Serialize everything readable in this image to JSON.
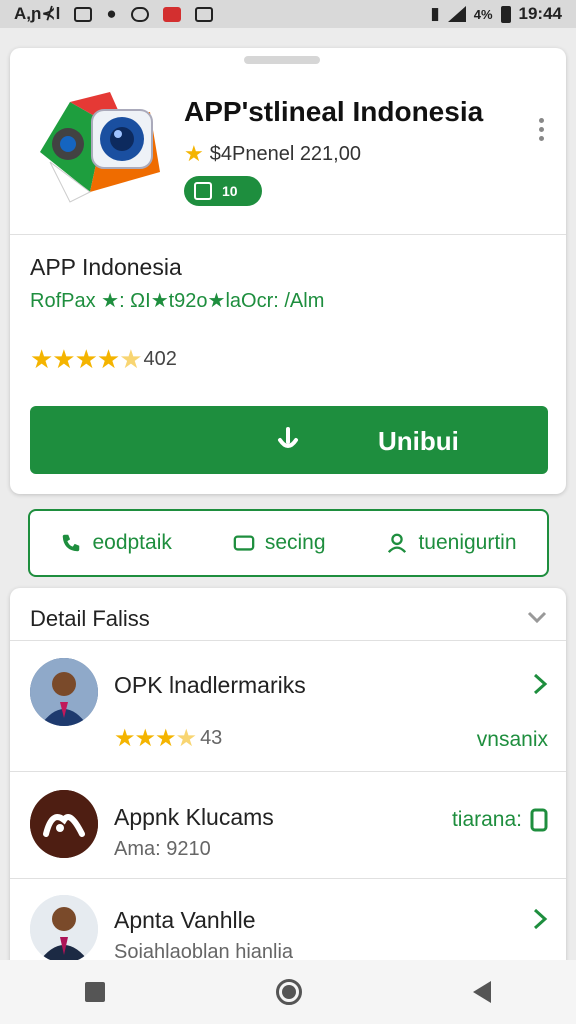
{
  "status_bar": {
    "carrier": "A,ɲ⊀l",
    "battery": "4%",
    "time": "19:44",
    "icons": [
      "mail-icon",
      "people-icon",
      "shield-icon",
      "youtube-icon",
      "image-icon",
      "vibrate-icon",
      "signal-icon",
      "battery-icon"
    ]
  },
  "app": {
    "title": "APP'stlineal Indonesia",
    "price": "$4Pnenel 221,00",
    "badge": "10",
    "name": "APP Indonesia",
    "meta": "RofPax ★: ΩI★t92o★laOcr: /Alm",
    "rating_stars": 4.5,
    "rating_count": "402",
    "install_label": "Unibui"
  },
  "actions": [
    {
      "label": "eodptaik",
      "icon": "phone-icon"
    },
    {
      "label": "secing",
      "icon": "square-icon"
    },
    {
      "label": "tuenigurtin",
      "icon": "person-icon"
    }
  ],
  "details": {
    "header": "Detail Faliss",
    "rows": [
      {
        "title": "OPK lnadlermariks",
        "rating": "43",
        "right": "vnsanix"
      },
      {
        "title": "Appnk Klucams",
        "sub": "Ama: 9210",
        "right": "tiarana:"
      },
      {
        "title": "Apnta Vanhlle",
        "sub": "Soiahlaoblan hianlia"
      }
    ]
  },
  "colors": {
    "accent": "#1e8e3e",
    "star": "#f4b400"
  }
}
